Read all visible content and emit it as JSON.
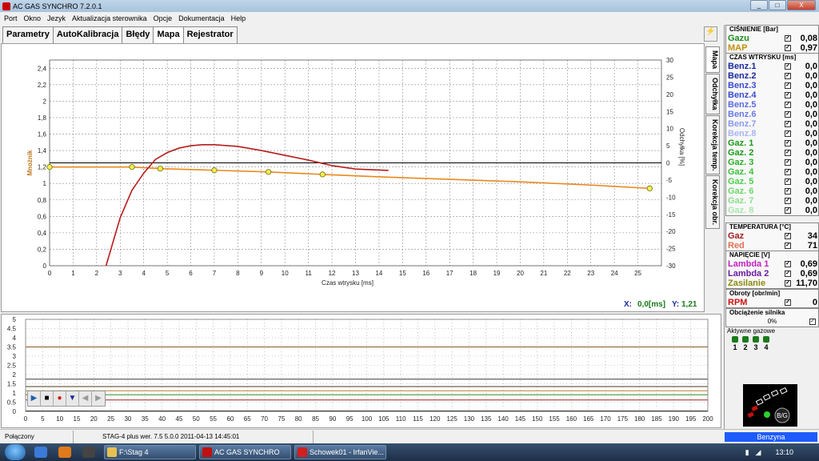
{
  "app": {
    "title": "AC GAS SYNCHRO  7.2.0.1"
  },
  "window_controls": {
    "minimize": "_",
    "maximize": "□",
    "close": "X"
  },
  "menu": [
    "Port",
    "Okno",
    "Jezyk",
    "Aktualizacja sterownika",
    "Opcje",
    "Dokumentacja",
    "Help"
  ],
  "tabs": [
    "Parametry",
    "AutoKalibracja",
    "Błędy",
    "Mapa",
    "Rejestrator"
  ],
  "active_tab": "Mapa",
  "vertical_tabs": [
    "Mapa",
    "Odchyłka",
    "Korekcja temp.",
    "Korekcja obr."
  ],
  "main_chart": {
    "y_left_label": "Mnożnik",
    "y_right_label": "Odchyłka [%]",
    "x_label": "Czas wtrysku [ms]",
    "cursor_x_label": "X:",
    "cursor_x_value": "0,0[ms]",
    "cursor_y_label": "Y:",
    "cursor_y_value": "1,21"
  },
  "chart_data": [
    {
      "type": "line",
      "xlabel": "Czas wtrysku [ms]",
      "ylabel": "Mnożnik",
      "y2label": "Odchyłka [%]",
      "xlim": [
        0,
        26
      ],
      "ylim": [
        0,
        2.5
      ],
      "y2lim": [
        -30,
        30
      ],
      "x_ticks": [
        0,
        1,
        2,
        3,
        4,
        5,
        6,
        7,
        8,
        9,
        10,
        11,
        12,
        13,
        14,
        15,
        16,
        17,
        18,
        19,
        20,
        21,
        22,
        23,
        24,
        25
      ],
      "y_ticks": [
        "0",
        "0,2",
        "0,4",
        "0,6",
        "0,8",
        "1",
        "1,2",
        "1,4",
        "1,6",
        "1,8",
        "2",
        "2,2",
        "2,4"
      ],
      "y_tick_values": [
        0,
        0.2,
        0.4,
        0.6,
        0.8,
        1.0,
        1.2,
        1.4,
        1.6,
        1.8,
        2.0,
        2.2,
        2.4
      ],
      "y2_ticks": [
        -30,
        -25,
        -20,
        -15,
        -10,
        -5,
        0,
        5,
        10,
        15,
        20,
        25,
        30
      ],
      "grid": true,
      "reference_line_y2": 0,
      "series": [
        {
          "color": "#e8891e",
          "axis": "left",
          "x": [
            0,
            3.5,
            4.7,
            7,
            9.3,
            11.6,
            14,
            17,
            20,
            23,
            25.5
          ],
          "y": [
            1.2,
            1.2,
            1.18,
            1.16,
            1.14,
            1.11,
            1.08,
            1.05,
            1.02,
            0.98,
            0.94
          ],
          "markers_x": [
            0,
            3.5,
            4.7,
            7,
            9.3,
            11.6,
            25.5
          ]
        },
        {
          "color": "#b81c1c",
          "axis": "right",
          "x": [
            2.4,
            3,
            3.5,
            4,
            4.5,
            5,
            5.5,
            6,
            6.5,
            7,
            8,
            9,
            10,
            11,
            12,
            13,
            14.4
          ],
          "y": [
            -30,
            -16,
            -8,
            -3,
            1,
            3,
            4.3,
            5,
            5.3,
            5.3,
            4.8,
            3.6,
            2.2,
            0.8,
            -0.8,
            -1.8,
            -2.2
          ]
        }
      ]
    },
    {
      "type": "line",
      "xlim": [
        0,
        200
      ],
      "ylim": [
        0,
        5
      ],
      "x_ticks": [
        0,
        5,
        10,
        15,
        20,
        25,
        30,
        35,
        40,
        45,
        50,
        55,
        60,
        65,
        70,
        75,
        80,
        85,
        90,
        95,
        100,
        105,
        110,
        115,
        120,
        125,
        130,
        135,
        140,
        145,
        150,
        155,
        160,
        165,
        170,
        175,
        180,
        185,
        190,
        195,
        200
      ],
      "y_ticks": [
        "0",
        "0.5",
        "1",
        "1.5",
        "2",
        "2.5",
        "3",
        "3.5",
        "4",
        "4.5",
        "5"
      ],
      "y_tick_values": [
        0,
        0.5,
        1,
        1.5,
        2,
        2.5,
        3,
        3.5,
        4,
        4.5,
        5
      ],
      "grid": true,
      "series": [
        {
          "color": "#8a5a20",
          "y": 3.5
        },
        {
          "color": "#3a3a3a",
          "y": 1.75
        },
        {
          "color": "#4b3b1b",
          "y": 1.35
        },
        {
          "color": "#c07a30",
          "y": 1.12
        },
        {
          "color": "#2a8a2a",
          "y": 0.9
        },
        {
          "color": "#a01e1e",
          "y": 0.62
        },
        {
          "color": "#000000",
          "y": 0.02
        }
      ]
    }
  ],
  "playback": [
    "▶",
    "■",
    "●",
    "▼",
    "◀",
    "▶"
  ],
  "sidebar": {
    "pressure": {
      "title": "CIŚNIENIE [Bar]",
      "rows": [
        {
          "name": "Gazu",
          "color": "#1e8a1e",
          "value": "0,08"
        },
        {
          "name": "MAP",
          "color": "#c09010",
          "value": "0,97"
        }
      ]
    },
    "injection": {
      "title": "CZAS WTRYSKU  [ms]",
      "rows": [
        {
          "name": "Benz.1",
          "color": "#1b2aa0",
          "value": "0,0"
        },
        {
          "name": "Benz.2",
          "color": "#1b2aa0",
          "value": "0,0"
        },
        {
          "name": "Benz.3",
          "color": "#3a4ad0",
          "value": "0,0"
        },
        {
          "name": "Benz.4",
          "color": "#3a4ad0",
          "value": "0,0"
        },
        {
          "name": "Benz.5",
          "color": "#5a6ae0",
          "value": "0,0"
        },
        {
          "name": "Benz.6",
          "color": "#6a7ae8",
          "value": "0,0"
        },
        {
          "name": "Benz.7",
          "color": "#8a9af0",
          "value": "0,0"
        },
        {
          "name": "Benz.8",
          "color": "#aab4f4",
          "value": "0,0"
        },
        {
          "name": "Gaz. 1",
          "color": "#1a9a1a",
          "value": "0,0"
        },
        {
          "name": "Gaz. 2",
          "color": "#1a9a1a",
          "value": "0,0"
        },
        {
          "name": "Gaz. 3",
          "color": "#2ab02a",
          "value": "0,0"
        },
        {
          "name": "Gaz. 4",
          "color": "#3ac03a",
          "value": "0,0"
        },
        {
          "name": "Gaz. 5",
          "color": "#4ad04a",
          "value": "0,0"
        },
        {
          "name": "Gaz. 6",
          "color": "#6ad86a",
          "value": "0,0"
        },
        {
          "name": "Gaz. 7",
          "color": "#8ae08a",
          "value": "0,0"
        },
        {
          "name": "Gaz. 8",
          "color": "#a8e8a8",
          "value": "0,0"
        }
      ]
    },
    "temperature": {
      "title": "TEMPERATURA  [°C]",
      "rows": [
        {
          "name": "Gaz",
          "color": "#a01e1e",
          "value": "34"
        },
        {
          "name": "Red",
          "color": "#e07050",
          "value": "71"
        }
      ]
    },
    "voltage": {
      "title": "NAPIĘCIE [V]",
      "rows": [
        {
          "name": "Lambda 1",
          "color": "#c020c0",
          "value": "0,69"
        },
        {
          "name": "Lambda 2",
          "color": "#6a1aa0",
          "value": "0,69"
        },
        {
          "name": "Zasilanie",
          "color": "#8a8a10",
          "value": "11,70"
        }
      ]
    },
    "rpm": {
      "title": "Obroty [obr/min]",
      "rows": [
        {
          "name": "RPM",
          "color": "#d01010",
          "value": "0"
        }
      ]
    },
    "load": {
      "title": "Obciążenie silnika",
      "value": "0%"
    },
    "active_gas": {
      "title": "Aktywne gazowe",
      "labels": [
        "1",
        "2",
        "3",
        "4"
      ]
    }
  },
  "status": {
    "connection": "Połączony",
    "device": "STAG-4 plus   wer. 7.5  5.0.0    2011-04-13 14:45:01",
    "fuel": "Benzyna"
  },
  "taskbar": {
    "tasks": [
      "F:\\Stag 4",
      "AC GAS SYNCHRO",
      "Schowek01 - IrfanVie..."
    ],
    "clock": "13:10"
  },
  "logo": {
    "badge": "B/G"
  }
}
